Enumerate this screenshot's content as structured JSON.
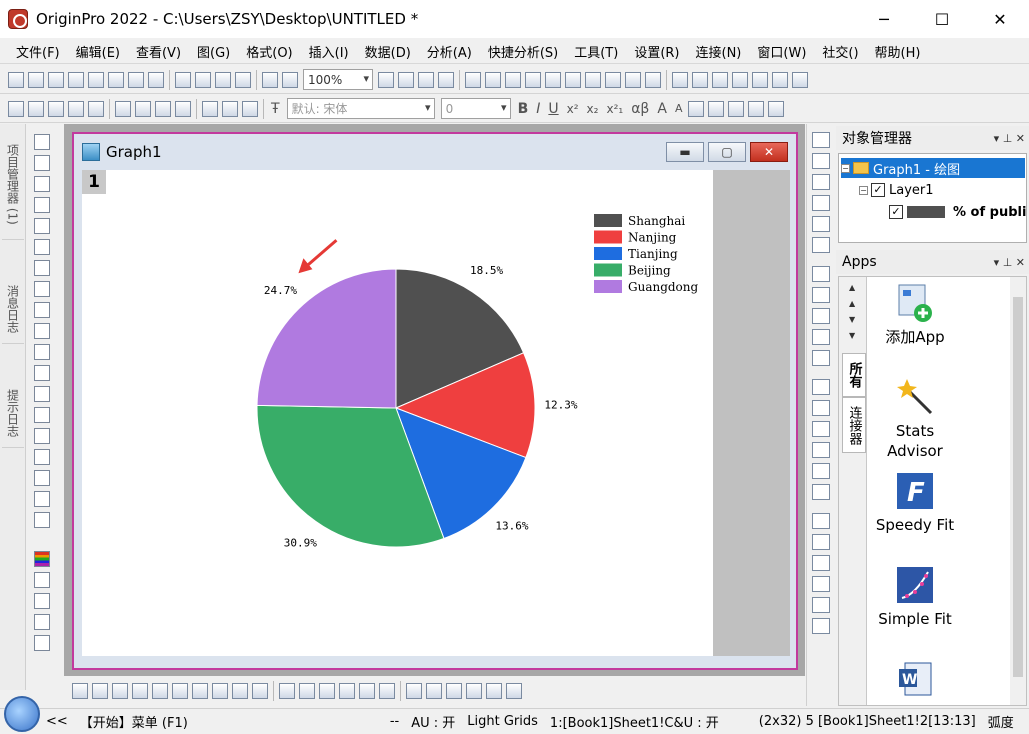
{
  "window": {
    "title": "OriginPro 2022 - C:\\Users\\ZSY\\Desktop\\UNTITLED *",
    "minimize": "─",
    "maximize": "☐",
    "close": "✕"
  },
  "menu": [
    "文件(F)",
    "编辑(E)",
    "查看(V)",
    "图(G)",
    "格式(O)",
    "插入(I)",
    "数据(D)",
    "分析(A)",
    "快捷分析(S)",
    "工具(T)",
    "设置(R)",
    "连接(N)",
    "窗口(W)",
    "社交()",
    "帮助(H)"
  ],
  "toolbar": {
    "zoom": "100%",
    "font_name": "默认: 宋体",
    "font_size": "0",
    "format_glyphs": [
      "B",
      "I",
      "U",
      "x²",
      "x₂",
      "x²₁",
      "αβ",
      "A",
      "A"
    ]
  },
  "left_dock": {
    "tabs": [
      "项目管理器 (1)",
      "消息日志",
      "提示日志"
    ]
  },
  "graph_window": {
    "title": "Graph1",
    "layer": "1"
  },
  "chart_data": {
    "type": "pie",
    "slices": [
      {
        "label": "Shanghai",
        "value": 18.5,
        "color": "#505050",
        "display": "18.5%"
      },
      {
        "label": "Nanjing",
        "value": 12.3,
        "color": "#ef3f3f",
        "display": "12.3%"
      },
      {
        "label": "Tianjing",
        "value": 13.6,
        "color": "#1e6de0",
        "display": "13.6%"
      },
      {
        "label": "Beijing",
        "value": 30.9,
        "color": "#38ad68",
        "display": "30.9%"
      },
      {
        "label": "Guangdong",
        "value": 24.7,
        "color": "#b07ae0",
        "display": "24.7%"
      }
    ],
    "start_angle_deg": 0,
    "direction": "clockwise",
    "legend_position": "top-right",
    "annotation_arrow_color": "#e53935"
  },
  "object_manager": {
    "header": "对象管理器",
    "graph": "Graph1 - 绘图",
    "layer": "Layer1",
    "plot": "% of publi"
  },
  "apps": {
    "header": "Apps",
    "tab_all": "所有",
    "tab_connector": "连接器",
    "items": [
      {
        "label": "添加App"
      },
      {
        "label": "Stats\nAdvisor"
      },
      {
        "label": "Speedy Fit"
      },
      {
        "label": "Simple Fit"
      }
    ]
  },
  "status": {
    "prev": "<<",
    "start_menu": "【开始】菜单 (F1)",
    "dashes": "--",
    "au": "AU : 开",
    "theme": "Light Grids",
    "book": "1:[Book1]Sheet1!C&U : 开",
    "info": "(2x32) 5 [Book1]Sheet1!2[13:13]",
    "angle": "弧度"
  }
}
